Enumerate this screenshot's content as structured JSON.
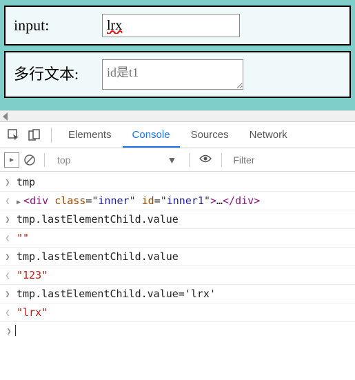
{
  "form": {
    "input_label": "input:",
    "input_value": "lrx",
    "textarea_label": "多行文本:",
    "textarea_placeholder": "id是t1",
    "textarea_value": ""
  },
  "devtools": {
    "tabs": {
      "elements": "Elements",
      "console": "Console",
      "sources": "Sources",
      "network": "Network"
    },
    "toolbar": {
      "context": "top",
      "filter_placeholder": "Filter"
    },
    "console": [
      {
        "dir": "in",
        "kind": "code",
        "text": "tmp"
      },
      {
        "dir": "out",
        "kind": "element",
        "tag": "div",
        "attrs": [
          [
            "class",
            "inner"
          ],
          [
            "id",
            "inner1"
          ]
        ]
      },
      {
        "dir": "in",
        "kind": "code",
        "text": "tmp.lastElementChild.value"
      },
      {
        "dir": "out",
        "kind": "string",
        "text": "\"\""
      },
      {
        "dir": "in",
        "kind": "code",
        "text": "tmp.lastElementChild.value"
      },
      {
        "dir": "out",
        "kind": "string",
        "text": "\"123\""
      },
      {
        "dir": "in",
        "kind": "code",
        "text": "tmp.lastElementChild.value='lrx'"
      },
      {
        "dir": "out",
        "kind": "string",
        "text": "\"lrx\""
      }
    ]
  }
}
